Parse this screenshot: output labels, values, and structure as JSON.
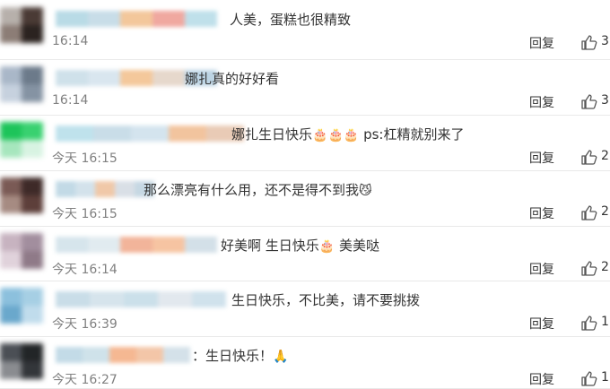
{
  "comments": [
    {
      "text": "人美，蛋糕也很精致",
      "time": "16:14",
      "reply": "回复",
      "likes": "3",
      "avatar_colors": [
        "#b7b0ab",
        "#4a3a35",
        "#8c7d76",
        "#2b2320"
      ],
      "name_colors": [
        "#b9dbe6",
        "#c8dde8",
        "#f3c79b",
        "#f0a8a0",
        "#bfe0ea"
      ]
    },
    {
      "text": "娜扎真的好好看",
      "time": "16:14",
      "reply": "回复",
      "likes": "3",
      "avatar_colors": [
        "#a9b7c8",
        "#6c7a8a",
        "#c6d1de",
        "#8593a3"
      ],
      "name_colors": [
        "#cfe1ea",
        "#d9e6ef",
        "#f4c89b",
        "#e6d8cc",
        "#bcd4e4"
      ]
    },
    {
      "text": "娜扎生日快乐",
      "emoji": [
        "🎂",
        "🎂",
        "🎂"
      ],
      "text_after": " ps:杠精就别来了",
      "time": "今天 16:15",
      "reply": "回复",
      "likes": "2",
      "avatar_colors": [
        "#1dc45a",
        "#39d170",
        "#a6e6bd",
        "#d8f3e2"
      ],
      "name_colors": [
        "#bfe2ec",
        "#c9dde8",
        "#d4e4ee",
        "#f2c49e",
        "#e9cbb6"
      ]
    },
    {
      "text": "那么漂亮有什么用，还不是得不到我",
      "emoji": [
        "😼"
      ],
      "time": "今天 16:15",
      "reply": "回复",
      "likes": "2",
      "avatar_colors": [
        "#7a5a55",
        "#3e2a28",
        "#a68b82",
        "#5d3f3a"
      ],
      "name_colors": [
        "#c2dae6",
        "#d3e2eb",
        "#f0c8a8",
        "#d9dfe6",
        "#c6d8e3"
      ]
    },
    {
      "text": "好美啊 生日快乐",
      "emoji": [
        "🎂"
      ],
      "text_after": " 美美哒",
      "time": "今天 16:14",
      "reply": "回复",
      "likes": "2",
      "avatar_colors": [
        "#c7b3c0",
        "#a28e9e",
        "#e0d2db",
        "#8f7a88"
      ],
      "name_colors": [
        "#d6e5ec",
        "#e1ebf0",
        "#f2b49a",
        "#f6c4a2",
        "#d3e0e8"
      ]
    },
    {
      "text": "生日快乐，不比美，请不要挑拨",
      "time": "今天 16:39",
      "reply": "回复",
      "likes": "1",
      "avatar_colors": [
        "#8cc0dd",
        "#a6cfe4",
        "#6aa8cc",
        "#c0dcec"
      ],
      "name_colors": [
        "#c9dde8",
        "#d6e4ec",
        "#cbe0ea",
        "#e2e8ee",
        "#d0e2ec"
      ]
    },
    {
      "text": "：生日快乐！",
      "emoji": [
        "🙏"
      ],
      "time": "今天 16:27",
      "reply": "回复",
      "likes": "1",
      "avatar_colors": [
        "#4b4f55",
        "#222527",
        "#8a8c90",
        "#33363a"
      ],
      "name_colors": [
        "#c3dbe7",
        "#cfe2ea",
        "#f5b892",
        "#f3c6a8",
        "#d4e1e9"
      ]
    }
  ]
}
